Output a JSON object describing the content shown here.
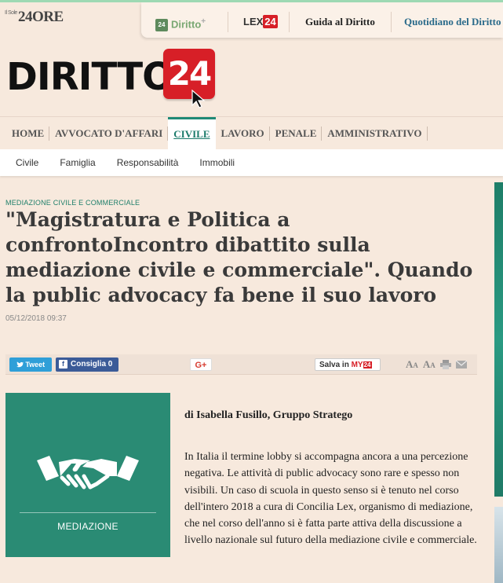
{
  "header": {
    "logo_24ore": "24ORE",
    "logo_24ore_prefix": "Il Sole",
    "links": {
      "diritto": "Diritto",
      "diritto_plus": "+",
      "diritto_book": "24",
      "lex_prefix": "LEX",
      "lex_suffix": "24",
      "guida": "Guida al Diritto",
      "quotidiano": "Quotidiano del Diritto"
    }
  },
  "brand": {
    "word": "DIRITTO",
    "number": "24"
  },
  "main_nav": {
    "items": [
      "HOME",
      "AVVOCATO D'AFFARI",
      "CIVILE",
      "LAVORO",
      "PENALE",
      "AMMINISTRATIVO"
    ],
    "active": "CIVILE"
  },
  "sub_nav": {
    "items": [
      "Civile",
      "Famiglia",
      "Responsabilità",
      "Immobili"
    ]
  },
  "article": {
    "kicker": "MEDIAZIONE CIVILE E COMMERCIALE",
    "title": "\"Magistratura e Politica a confrontoIncontro dibattito sulla mediazione civile e commerciale\". Quando la public advocacy fa bene il suo lavoro",
    "date": "05/12/2018 09:37",
    "image_label": "MEDIAZIONE",
    "byline": "di Isabella Fusillo, Gruppo Stratego",
    "body": "In Italia il termine lobby si accompagna ancora a una percezione negativa. Le attività di public advocacy sono rare e spesso non visibili. Un caso di scuola in questo senso si è tenuto nel corso dell'intero 2018 a cura di Concilia Lex, organismo di mediazione, che nel corso dell'anno si è fatta parte attiva della discussione a livello nazionale sul futuro della mediazione civile e commerciale."
  },
  "share": {
    "tweet": "Tweet",
    "consiglia": "Consiglia 0",
    "gplus": "G+",
    "salva_prefix": "Salva in",
    "salva_my": "MY",
    "salva_24": "24"
  },
  "colors": {
    "accent": "#1f8a77",
    "brand_red": "#d71f27",
    "background": "#f7e9dd"
  }
}
